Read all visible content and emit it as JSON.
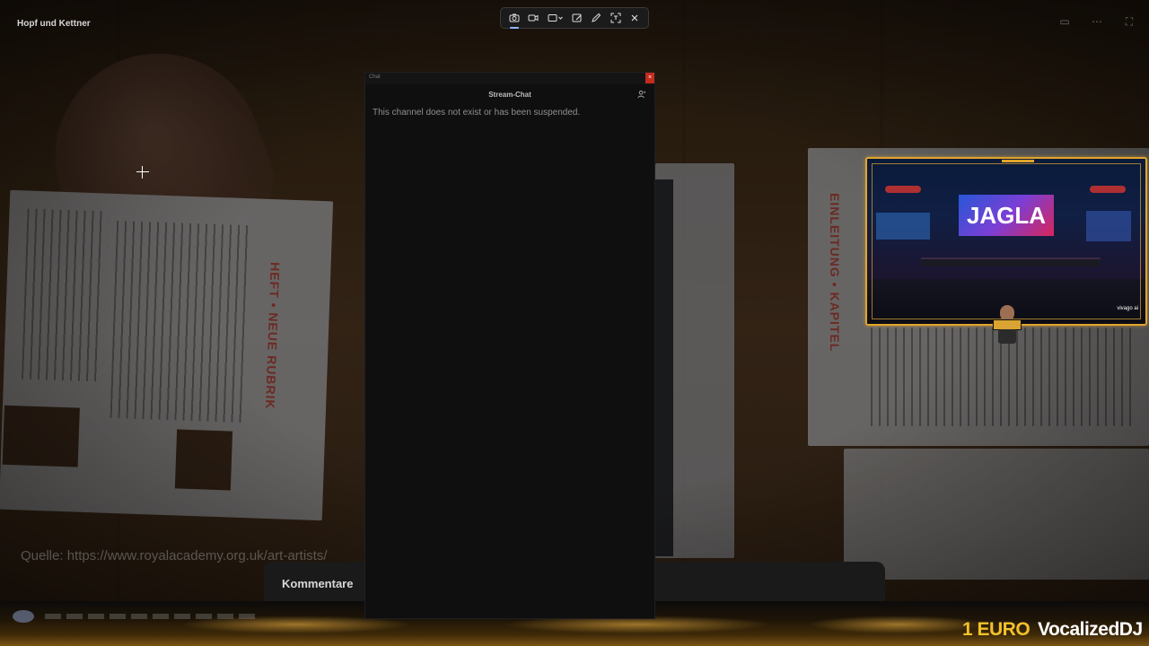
{
  "video": {
    "title": "Hopf und Kettner",
    "source_caption": "Quelle: https://www.royalacademy.org.uk/art-artists/",
    "comments_label": "Kommentare"
  },
  "snipping_toolbar": {
    "buttons": [
      {
        "name": "screenshot-mode",
        "icon": "camera-icon",
        "active": true
      },
      {
        "name": "record-mode",
        "icon": "video-icon",
        "active": false
      },
      {
        "name": "shape-mode",
        "icon": "rectangle-dropdown-icon",
        "active": false
      },
      {
        "name": "window-mode",
        "icon": "window-edit-icon",
        "active": false
      },
      {
        "name": "freeform-mode",
        "icon": "pen-icon",
        "active": false
      },
      {
        "name": "text-actions",
        "icon": "text-scan-icon",
        "active": false
      },
      {
        "name": "close",
        "icon": "close-icon",
        "active": false
      }
    ]
  },
  "chat": {
    "window_label": "Chat",
    "heading": "Stream-Chat",
    "message": "This channel does not exist or has been suspended."
  },
  "overlay": {
    "logo_text": "JAGLA",
    "brand": "vivago ai",
    "accent_color": "#e1a52d"
  },
  "ticker": {
    "donation_amount": "1 EURO",
    "donor_name": "VocalizedDJ"
  }
}
